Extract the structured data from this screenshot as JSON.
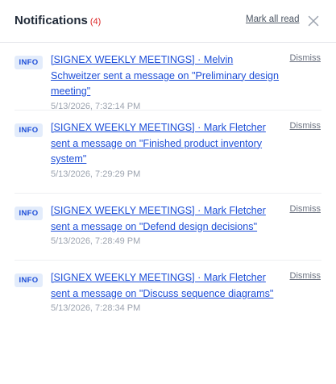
{
  "header": {
    "title": "Notifications",
    "count": "(4)",
    "mark_all_label": "Mark all read"
  },
  "notifications": [
    {
      "badge": "INFO",
      "message": "[SIGNEX WEEKLY MEETINGS] · Melvin Schweitzer sent a message on \"Preliminary design meeting\"",
      "time": "5/13/2026, 7:32:14 PM",
      "dismiss_label": "Dismiss"
    },
    {
      "badge": "INFO",
      "message": "[SIGNEX WEEKLY MEETINGS] · Mark Fletcher sent a message on \"Finished product inventory system\"",
      "time": "5/13/2026, 7:29:29 PM",
      "dismiss_label": "Dismiss"
    },
    {
      "badge": "INFO",
      "message": "[SIGNEX WEEKLY MEETINGS] · Mark Fletcher sent a message on \"Defend design decisions\"",
      "time": "5/13/2026, 7:28:49 PM",
      "dismiss_label": "Dismiss"
    },
    {
      "badge": "INFO",
      "message": "[SIGNEX WEEKLY MEETINGS] · Mark Fletcher sent a message on \"Discuss sequence diagrams\"",
      "time": "5/13/2026, 7:28:34 PM",
      "dismiss_label": "Dismiss"
    }
  ],
  "colors": {
    "accent": "#1d4ed8",
    "badge_bg": "#e3ecfb",
    "count": "#dc2626"
  },
  "icons": {
    "close": "close-icon"
  }
}
